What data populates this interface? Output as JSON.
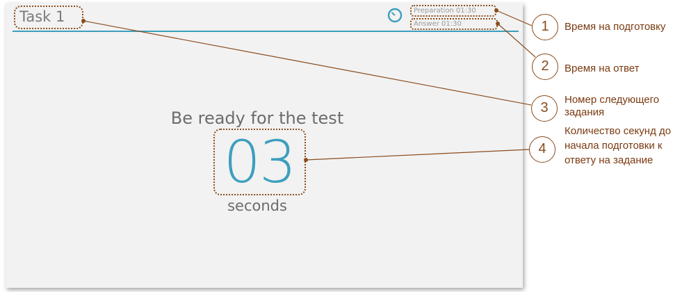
{
  "task": {
    "title": "Task 1"
  },
  "timers": {
    "preparation": "Preparation 01:30",
    "answer": "Answer 01:30"
  },
  "main": {
    "ready_text": "Be ready for the test",
    "countdown": "03",
    "seconds_label": "seconds"
  },
  "annotations": [
    {
      "number": "1",
      "text": "Время на подготовку"
    },
    {
      "number": "2",
      "text": "Время на ответ"
    },
    {
      "number": "3",
      "text_line1": "Номер следующего",
      "text_line2": "задания"
    },
    {
      "number": "4",
      "text_line1": "Количество секунд до",
      "text_line2": "начала подготовки к",
      "text_line3": "ответу на задание"
    }
  ],
  "colors": {
    "accent": "#3c9fbe",
    "annotation": "#8a4b1c",
    "background": "#f2f2f2"
  },
  "icons": {
    "clock": "clock-icon"
  }
}
